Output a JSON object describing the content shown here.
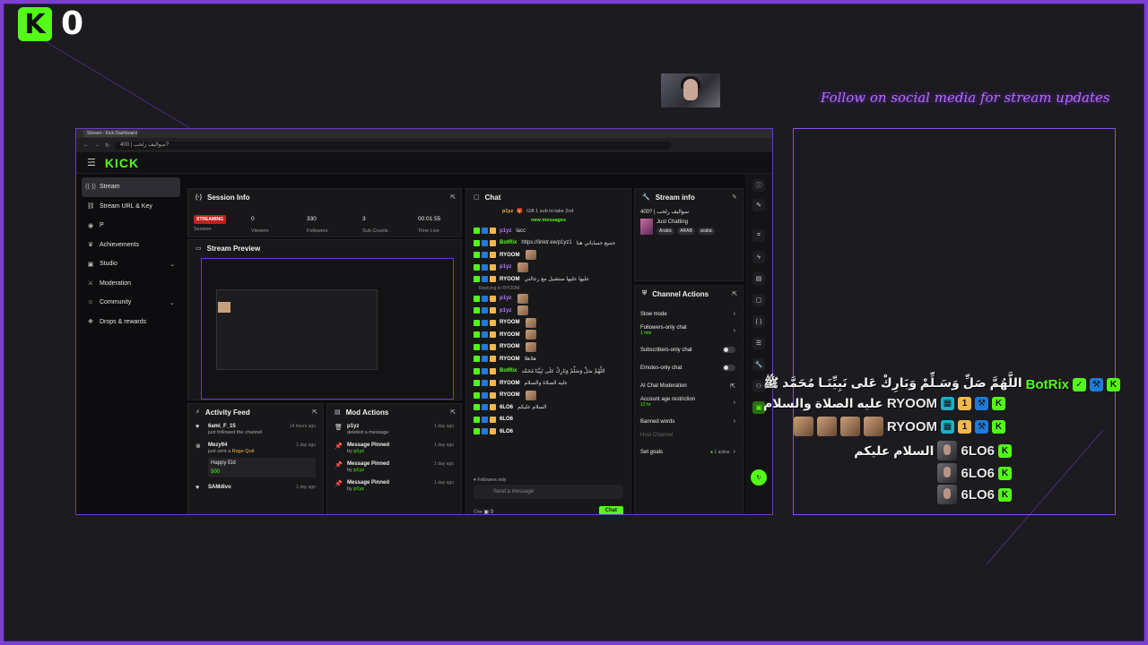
{
  "overlay": {
    "viewer_count": "0",
    "social_text": "Follow on social media for stream updates",
    "accent": "#7b3fd1",
    "kick_green": "#53fc18"
  },
  "browser": {
    "tab_title": "Stream - Kick Dashboard",
    "url": "سوالیف رلحب | 400?"
  },
  "kick": {
    "brand": "KICK",
    "sidebar": [
      {
        "label": "Stream",
        "icon": "broadcast-icon",
        "active": true
      },
      {
        "label": "Stream URL & Key",
        "icon": "link-icon"
      },
      {
        "label": "P",
        "icon": "person-icon"
      },
      {
        "label": "Achievements",
        "icon": "trophy-icon"
      },
      {
        "label": "Studio",
        "icon": "studio-icon",
        "chevron": true
      },
      {
        "label": "Moderation",
        "icon": "sword-icon"
      },
      {
        "label": "Community",
        "icon": "people-icon",
        "chevron": true
      },
      {
        "label": "Drops & rewards",
        "icon": "gift-icon"
      }
    ],
    "session": {
      "title": "Session Info",
      "status": "STREAMING",
      "status_label": "Session",
      "viewers": "0",
      "viewers_label": "Viewers",
      "followers": "330",
      "followers_label": "Followers",
      "subs": "3",
      "subs_label": "Sub Counts",
      "time": "00:01:55",
      "time_label": "Time Live"
    },
    "preview": {
      "title": "Stream Preview"
    },
    "activity": {
      "title": "Activity Feed",
      "items": [
        {
          "user": "6ami_F_15",
          "text": "just followed the channel",
          "time": "14 hours ago",
          "icon": "heart-icon"
        },
        {
          "user": "Mezy94",
          "text": "just sent a",
          "highlight": "Rage Quit",
          "time": "1 day ago",
          "icon": "kick-icon",
          "card_title": "Happy Eid",
          "card_amount": "500"
        },
        {
          "user": "SAMdivo",
          "text": "",
          "time": "1 day ago",
          "icon": "heart-icon"
        }
      ]
    },
    "mod": {
      "title": "Mod Actions",
      "items": [
        {
          "user": "p1yz",
          "text": "deleted a message",
          "time": "1 day ago",
          "icon": "trash-icon"
        },
        {
          "user": "Message Pinned",
          "by": "by",
          "byuser": "p1yz",
          "time": "1 day ago",
          "icon": "pin-icon"
        },
        {
          "user": "Message Pinned",
          "by": "by",
          "byuser": "p1yz",
          "time": "1 day ago",
          "icon": "pin-icon"
        },
        {
          "user": "Message Pinned",
          "by": "by",
          "byuser": "p1yz",
          "time": "1 day ago",
          "icon": "pin-icon"
        }
      ]
    },
    "chat": {
      "title": "Chat",
      "gift_user": "p1yz",
      "gift_text": "Gift 1 sub to take 2nd",
      "new_messages": "new messages",
      "messages": [
        {
          "user": "p1yz",
          "text": "lacc",
          "color": "p"
        },
        {
          "user": "BotRix",
          "text": "https://linktr.ee/p1yz1",
          "color": "g",
          "suffix": "جميع حساباتي هنا"
        },
        {
          "user": "RYOOM",
          "text": "",
          "emote": true
        },
        {
          "user": "p1yz",
          "text": "",
          "emote": true,
          "color": "p"
        },
        {
          "user": "RYOOM",
          "text": "عليها عليها ستشيل مع رجالتي"
        },
        {
          "user": "p1yz",
          "text": "",
          "emote": true,
          "color": "p"
        },
        {
          "user": "p1yz",
          "text": "",
          "emote": true,
          "color": "p"
        },
        {
          "user": "RYOOM",
          "text": "",
          "emote": true
        },
        {
          "user": "RYOOM",
          "text": "",
          "emote": true
        },
        {
          "user": "RYOOM",
          "text": "",
          "emote": true
        },
        {
          "user": "RYOOM",
          "text": "هلاهلا"
        },
        {
          "user": "BotRix",
          "text": "اللَّهُمَّ صَلِّ وَسَلِّمْ وَبَارِكْ عَلَى نَبِيِّنَا مُحَمَّد",
          "color": "g"
        },
        {
          "user": "RYOOM",
          "text": "عليه الصلاة والسلام"
        },
        {
          "user": "RYOOM",
          "text": "",
          "emote": true
        },
        {
          "user": "6LO6",
          "text": "السلام عليكم"
        },
        {
          "user": "6LO6",
          "text": ""
        },
        {
          "user": "6LO6",
          "text": ""
        }
      ],
      "replying": "Replying to RYOOM:",
      "followers_only": "Followers only",
      "placeholder": "Send a message",
      "send_label": "Chat",
      "points": "0"
    },
    "stream_info": {
      "title": "Stream info",
      "stream_title": "400? | سوالیف رلحب",
      "category": "Just Chatting",
      "tags": [
        "Arabic",
        "ARAB",
        "arabic"
      ]
    },
    "channel_actions": {
      "title": "Channel Actions",
      "items": [
        {
          "label": "Slow mode",
          "type": "chevron"
        },
        {
          "label": "Followers-only chat",
          "sub": "1 min",
          "type": "chevron"
        },
        {
          "label": "Subscribers-only chat",
          "type": "toggle"
        },
        {
          "label": "Emotes-only chat",
          "type": "toggle"
        },
        {
          "label": "AI Chat Moderation",
          "type": "ext"
        },
        {
          "label": "Account age restriction",
          "sub": "12 hr",
          "type": "chevron"
        },
        {
          "label": "Banned words",
          "type": "chevron"
        },
        {
          "label": "Host Channel",
          "type": "none",
          "dim": true
        },
        {
          "label": "Set goals",
          "badge": "1 active",
          "type": "chevron"
        }
      ]
    }
  },
  "chat_overlay": [
    {
      "user": "BotRix",
      "text": "اللَّهُمَّ صَلِّ وَسَـلِّمْ وَبَارِكْ عَلى نَبِيِّنَـا مُحَمَّد ﷺ",
      "bot": true
    },
    {
      "user": "RYOOM",
      "text": "عليه الصلاة والسلام"
    },
    {
      "user": "RYOOM",
      "text": "",
      "emotes": 4
    },
    {
      "user": "6LO6",
      "text": "السلام عليكم",
      "face": true
    },
    {
      "user": "6LO6",
      "text": "",
      "face": true
    },
    {
      "user": "6LO6",
      "text": "",
      "face": true
    }
  ]
}
